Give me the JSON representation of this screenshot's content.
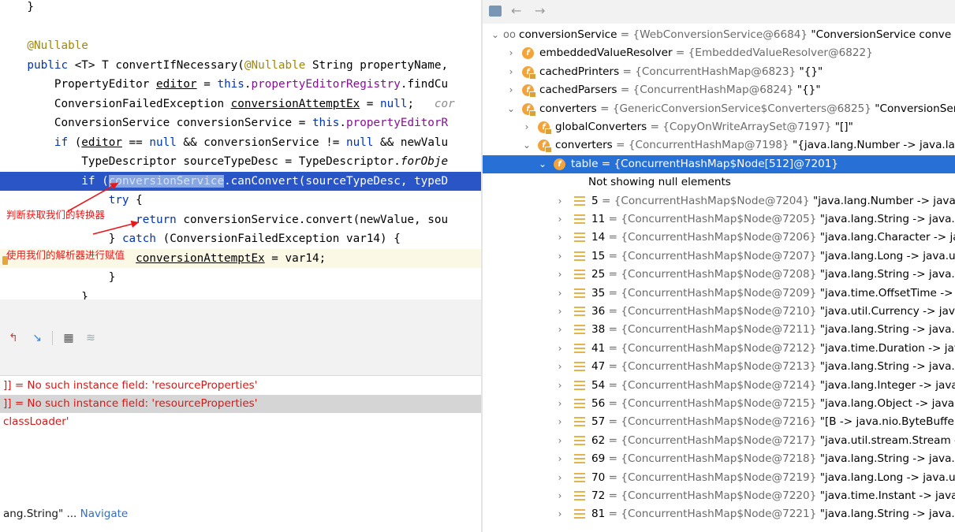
{
  "editor": {
    "lines": [
      {
        "tokens": [
          {
            "t": "    }",
            "c": ""
          }
        ],
        "state": "normal"
      },
      {
        "tokens": [],
        "state": "normal"
      },
      {
        "tokens": [
          {
            "t": "    @Nullable",
            "c": "anno"
          }
        ],
        "state": "normal"
      },
      {
        "tokens": [
          {
            "t": "    public ",
            "c": "kw"
          },
          {
            "t": "<T> T convertIfNecessary(",
            "c": ""
          },
          {
            "t": "@Nullable",
            "c": "anno"
          },
          {
            "t": " String propertyName,",
            "c": ""
          }
        ],
        "state": "normal"
      },
      {
        "tokens": [
          {
            "t": "        PropertyEditor ",
            "c": ""
          },
          {
            "t": "editor",
            "c": "var-u"
          },
          {
            "t": " = ",
            "c": ""
          },
          {
            "t": "this",
            "c": "kw"
          },
          {
            "t": ".",
            "c": ""
          },
          {
            "t": "propertyEditorRegistry",
            "c": "fld"
          },
          {
            "t": ".findCu",
            "c": ""
          }
        ],
        "state": "normal"
      },
      {
        "tokens": [
          {
            "t": "        ConversionFailedException ",
            "c": ""
          },
          {
            "t": "conversionAttemptEx",
            "c": "var-u"
          },
          {
            "t": " = ",
            "c": ""
          },
          {
            "t": "null",
            "c": "kw"
          },
          {
            "t": ";   ",
            "c": ""
          },
          {
            "t": "cor",
            "c": "cmt"
          }
        ],
        "state": "normal"
      },
      {
        "tokens": [
          {
            "t": "        ConversionService conversionService = ",
            "c": ""
          },
          {
            "t": "this",
            "c": "kw"
          },
          {
            "t": ".",
            "c": ""
          },
          {
            "t": "propertyEditorR",
            "c": "fld"
          }
        ],
        "state": "normal"
      },
      {
        "tokens": [
          {
            "t": "        if ",
            "c": "kw"
          },
          {
            "t": "(",
            "c": ""
          },
          {
            "t": "editor",
            "c": "var-u"
          },
          {
            "t": " == ",
            "c": ""
          },
          {
            "t": "null",
            "c": "kw"
          },
          {
            "t": " && conversionService != ",
            "c": ""
          },
          {
            "t": "null",
            "c": "kw"
          },
          {
            "t": " && newValu",
            "c": ""
          }
        ],
        "state": "normal"
      },
      {
        "tokens": [
          {
            "t": "            TypeDescriptor sourceTypeDesc = TypeDescriptor.",
            "c": ""
          },
          {
            "t": "forObje",
            "c": "italic"
          }
        ],
        "state": "normal"
      },
      {
        "tokens": [
          {
            "t": "            if (",
            "c": ""
          },
          {
            "t": "conversionService",
            "c": "hl"
          },
          {
            "t": ".canConvert(sourceTypeDesc, typeD",
            "c": ""
          }
        ],
        "state": "exec"
      },
      {
        "tokens": [
          {
            "t": "                try ",
            "c": "kw"
          },
          {
            "t": "{",
            "c": ""
          }
        ],
        "state": "normal"
      },
      {
        "tokens": [
          {
            "t": "                    return ",
            "c": "kw"
          },
          {
            "t": "conversionService.convert(newValue, sou",
            "c": ""
          }
        ],
        "state": "normal"
      },
      {
        "tokens": [
          {
            "t": "                } ",
            "c": ""
          },
          {
            "t": "catch",
            "c": "kw"
          },
          {
            "t": " (ConversionFailedException var14) {",
            "c": ""
          }
        ],
        "state": "normal"
      },
      {
        "tokens": [
          {
            "t": "                    ",
            "c": ""
          },
          {
            "t": "conversionAttemptEx",
            "c": "var-u"
          },
          {
            "t": " = var14;",
            "c": ""
          }
        ],
        "state": "caret"
      },
      {
        "tokens": [
          {
            "t": "                }",
            "c": ""
          }
        ],
        "state": "normal"
      },
      {
        "tokens": [
          {
            "t": "            }",
            "c": ""
          }
        ],
        "state": "normal"
      }
    ],
    "annotations": {
      "judge": "判断获取我们的转换器",
      "use": "使用我们的解析器进行赋值"
    }
  },
  "debug_toolbar": {
    "icons": [
      "step-out-icon",
      "run-to-cursor-icon",
      "evaluate-icon",
      "trace-icon"
    ]
  },
  "console": {
    "lines": [
      {
        "text": "]] = No such instance field: 'resourceProperties'",
        "selected": false
      },
      {
        "text": "]] = No such instance field: 'resourceProperties'",
        "selected": true
      },
      {
        "text": "classLoader'",
        "selected": false
      }
    ],
    "nav_prefix": "ang.String\" ... ",
    "nav_link": "Navigate"
  },
  "vars": {
    "toolbar": {
      "icons": [
        "restore-layout-icon",
        "back-arrow-icon",
        "forward-arrow-icon"
      ]
    },
    "rows": [
      {
        "level": 0,
        "arrow": "v",
        "icon": "oo",
        "name": "conversionService",
        "type": " = {WebConversionService@6684} ",
        "value": "\"ConversionService conve"
      },
      {
        "level": 1,
        "arrow": ">",
        "icon": "f",
        "name": "embeddedValueResolver",
        "type": " = {EmbeddedValueResolver@6822}",
        "value": ""
      },
      {
        "level": 1,
        "arrow": ">",
        "icon": "f-lock",
        "name": "cachedPrinters",
        "type": " = {ConcurrentHashMap@6823} ",
        "value": "\"{}\""
      },
      {
        "level": 1,
        "arrow": ">",
        "icon": "f-lock",
        "name": "cachedParsers",
        "type": " = {ConcurrentHashMap@6824} ",
        "value": "\"{}\""
      },
      {
        "level": 1,
        "arrow": "v",
        "icon": "f-lock",
        "name": "converters",
        "type": " = {GenericConversionService$Converters@6825} ",
        "value": "\"ConversionSer"
      },
      {
        "level": 2,
        "arrow": ">",
        "icon": "f-lock",
        "name": "globalConverters",
        "type": " = {CopyOnWriteArraySet@7197} ",
        "value": "\"[]\""
      },
      {
        "level": 2,
        "arrow": "v",
        "icon": "f-lock",
        "name": "converters",
        "type": " = {ConcurrentHashMap@7198} ",
        "value": "\"{java.lang.Number -> java.lan"
      },
      {
        "level": 3,
        "arrow": "v",
        "icon": "f",
        "name": "table",
        "type": " = {ConcurrentHashMap$Node[512]@7201}",
        "value": "",
        "selected": true
      },
      {
        "level": 4,
        "arrow": "",
        "icon": "",
        "name": "Not showing null elements",
        "type": "",
        "value": ""
      },
      {
        "level": 4,
        "arrow": ">",
        "icon": "list",
        "name": "5",
        "type": " = {ConcurrentHashMap$Node@7204} ",
        "value": "\"java.lang.Number -> java."
      },
      {
        "level": 4,
        "arrow": ">",
        "icon": "list",
        "name": "11",
        "type": " = {ConcurrentHashMap$Node@7205} ",
        "value": "\"java.lang.String -> java.n"
      },
      {
        "level": 4,
        "arrow": ">",
        "icon": "list",
        "name": "14",
        "type": " = {ConcurrentHashMap$Node@7206} ",
        "value": "\"java.lang.Character -> jav"
      },
      {
        "level": 4,
        "arrow": ">",
        "icon": "list",
        "name": "15",
        "type": " = {ConcurrentHashMap$Node@7207} ",
        "value": "\"java.lang.Long -> java.uti"
      },
      {
        "level": 4,
        "arrow": ">",
        "icon": "list",
        "name": "25",
        "type": " = {ConcurrentHashMap$Node@7208} ",
        "value": "\"java.lang.String -> java.u"
      },
      {
        "level": 4,
        "arrow": ">",
        "icon": "list",
        "name": "35",
        "type": " = {ConcurrentHashMap$Node@7209} ",
        "value": "\"java.time.OffsetTime -> j"
      },
      {
        "level": 4,
        "arrow": ">",
        "icon": "list",
        "name": "36",
        "type": " = {ConcurrentHashMap$Node@7210} ",
        "value": "\"java.util.Currency -> java"
      },
      {
        "level": 4,
        "arrow": ">",
        "icon": "list",
        "name": "38",
        "type": " = {ConcurrentHashMap$Node@7211} ",
        "value": "\"java.lang.String -> java.u"
      },
      {
        "level": 4,
        "arrow": ">",
        "icon": "list",
        "name": "41",
        "type": " = {ConcurrentHashMap$Node@7212} ",
        "value": "\"java.time.Duration -> jav"
      },
      {
        "level": 4,
        "arrow": ">",
        "icon": "list",
        "name": "47",
        "type": " = {ConcurrentHashMap$Node@7213} ",
        "value": "\"java.lang.String -> java.ti"
      },
      {
        "level": 4,
        "arrow": ">",
        "icon": "list",
        "name": "54",
        "type": " = {ConcurrentHashMap$Node@7214} ",
        "value": "\"java.lang.Integer -> java."
      },
      {
        "level": 4,
        "arrow": ">",
        "icon": "list",
        "name": "56",
        "type": " = {ConcurrentHashMap$Node@7215} ",
        "value": "\"java.lang.Object -> java.l"
      },
      {
        "level": 4,
        "arrow": ">",
        "icon": "list",
        "name": "57",
        "type": " = {ConcurrentHashMap$Node@7216} ",
        "value": "\"[B -> java.nio.ByteBuffer"
      },
      {
        "level": 4,
        "arrow": ">",
        "icon": "list",
        "name": "62",
        "type": " = {ConcurrentHashMap$Node@7217} ",
        "value": "\"java.util.stream.Stream -"
      },
      {
        "level": 4,
        "arrow": ">",
        "icon": "list",
        "name": "69",
        "type": " = {ConcurrentHashMap$Node@7218} ",
        "value": "\"java.lang.String -> java.ti"
      },
      {
        "level": 4,
        "arrow": ">",
        "icon": "list",
        "name": "70",
        "type": " = {ConcurrentHashMap$Node@7219} ",
        "value": "\"java.lang.Long -> java.ut"
      },
      {
        "level": 4,
        "arrow": ">",
        "icon": "list",
        "name": "72",
        "type": " = {ConcurrentHashMap$Node@7220} ",
        "value": "\"java.time.Instant -> java."
      },
      {
        "level": 4,
        "arrow": ">",
        "icon": "list",
        "name": "81",
        "type": " = {ConcurrentHashMap$Node@7221} ",
        "value": "\"java.lang.String -> java.ti"
      }
    ]
  }
}
